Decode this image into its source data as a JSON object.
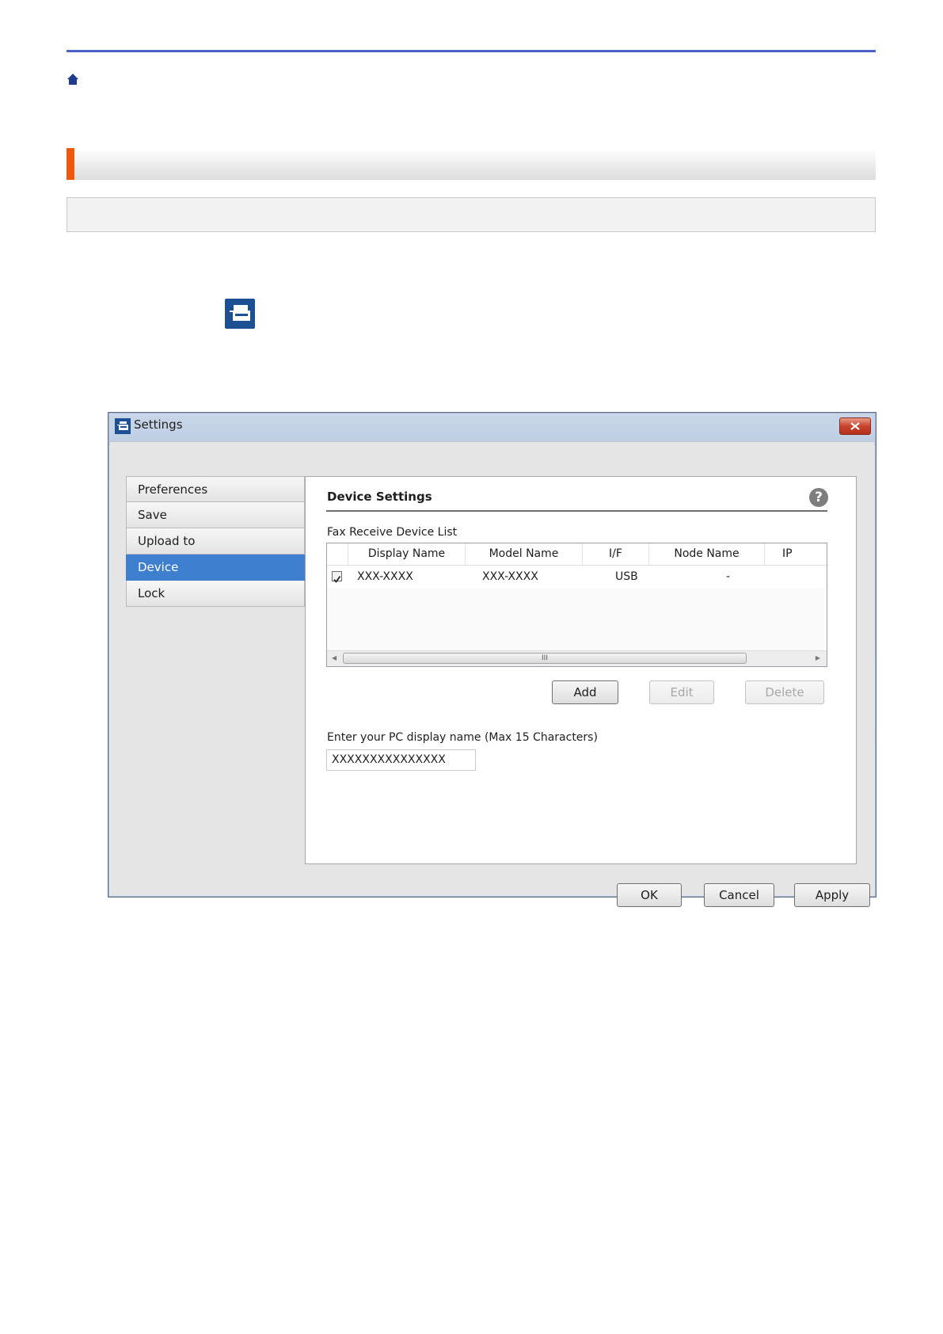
{
  "page": {
    "icons": {
      "home": "home-icon",
      "app": "fax-receive-app-icon"
    },
    "colors": {
      "rule": "#4a63c9",
      "accent": "#f0570c",
      "app_icon": "#1d4f94",
      "selected": "#3f7fd0"
    }
  },
  "dialog": {
    "title": "Settings",
    "close_icon": "close-icon",
    "sidebar": {
      "items": [
        {
          "label": "Preferences"
        },
        {
          "label": "Save"
        },
        {
          "label": "Upload to"
        },
        {
          "label": "Device",
          "selected": true
        },
        {
          "label": "Lock"
        }
      ]
    },
    "panel": {
      "title": "Device Settings",
      "help_icon": "?",
      "list_label": "Fax Receive Device List",
      "columns": [
        "Display Name",
        "Model Name",
        "I/F",
        "Node Name",
        "IP"
      ],
      "rows": [
        {
          "checked": true,
          "display_name": "XXX-XXXX",
          "model_name": "XXX-XXXX",
          "if": "USB",
          "node_name": "-"
        }
      ],
      "scroll_thumb": "III",
      "buttons": {
        "add": "Add",
        "edit": "Edit",
        "delete": "Delete"
      },
      "name_label": "Enter your PC display name (Max 15 Characters)",
      "name_value": "XXXXXXXXXXXXXXX"
    },
    "footer": {
      "ok": "OK",
      "cancel": "Cancel",
      "apply": "Apply"
    }
  }
}
